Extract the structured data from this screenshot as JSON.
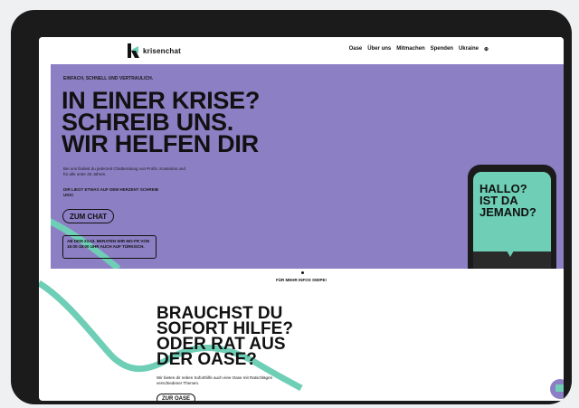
{
  "brand": {
    "name": "krisenchat"
  },
  "nav": {
    "items": [
      "Oase",
      "Über uns",
      "Mitmachen",
      "Spenden",
      "Ukraine",
      "⊕"
    ]
  },
  "hero": {
    "eyebrow": "EINFACH, SCHNELL UND VERTRAULICH.",
    "headline": [
      "IN EINER KRISE?",
      "SCHREIB UNS.",
      "WIR HELFEN DIR"
    ],
    "description": "Bei uns findest du jederzeit Chatberatung von Profis. Kostenlos und für alle unter 25 Jahren.",
    "lead": "DIR LIEGT ETWAS AUF DEM HERZEN? SCHREIB UNS!",
    "cta_label": "ZUM CHAT",
    "notice": "AB DEM 23.03. BERATEN WIR MO-FR VON 16:00-18:00 UHR AUCH AUF TÜRKISCH.",
    "phone_message": [
      "HALLO?",
      "IST DA",
      "JEMAND?"
    ]
  },
  "swipe_hint": "FÜR MEHR INFOS SWIPE!",
  "oase": {
    "headline": [
      "BRAUCHST DU",
      "SOFORT HILFE?",
      "ODER RAT AUS",
      "DER OASE?"
    ],
    "text": "Wir bieten dir neben Soforthilfe auch eine Oase mit Ratschlägen verschiedener Themen.",
    "cta_label": "ZUR OASE"
  },
  "colors": {
    "purple": "#8d7fc4",
    "mint": "#6fcfb6",
    "dark": "#111111"
  },
  "icons": {
    "chat_fab": "chat-bubble-icon",
    "language": "globe-icon"
  }
}
